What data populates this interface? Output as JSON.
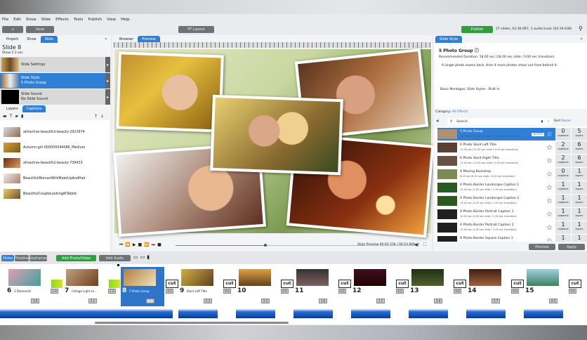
{
  "menu": [
    "File",
    "Edit",
    "Show",
    "Slide",
    "Effects",
    "Tools",
    "Publish",
    "View",
    "Help"
  ],
  "toolbar": {
    "home": "⌂",
    "save": "Save",
    "layout": "FF Layout",
    "publish": "Publish",
    "status": "27 slides, 02:36.067, 1 audio track (02:19.636)"
  },
  "left": {
    "tabs": [
      "Project",
      "Show",
      "Slide"
    ],
    "title": "Slide 8",
    "subtitle": "Show 2 2 sec",
    "rows": [
      {
        "t1": "Slide Settings",
        "t2": ""
      },
      {
        "t1": "Slide Style",
        "t2": "5 Photo Group"
      },
      {
        "t1": "Slide Sound",
        "t2": "No Slide Sound"
      }
    ],
    "layer_tabs": [
      "Layers",
      "Captions"
    ],
    "layers": [
      "attractive-beautiful-beauty-2923974",
      "Autumn-girl-000045044086_Medium",
      "attractive-beautiful-beauty-739433",
      "BeautifulWomanWithMakeUpAndHair",
      "BeautifulCoupleLookingAtTablet"
    ]
  },
  "center": {
    "tabs": [
      "Browser",
      "Preview"
    ],
    "status": "Style Preview 00:05.530 / 00:10.000"
  },
  "right": {
    "tab": "Slide Style",
    "title": "5 Photo Group",
    "duration": "Recommended Duration: 18.00 sec (18.00 sec slide / 0.00 sec transition)",
    "desc": "A single photo zooms back, then 4 more photos shear out from behind it.",
    "source": "Basic Montages, Slide Styles - Built In",
    "category_label": "Category:",
    "category": "All Effects",
    "search_placeholder": "Search",
    "sort_label": "Sort",
    "sort_value": "Name",
    "active": "active",
    "captions": "captions",
    "layers": "layers",
    "effects": [
      {
        "name": "5 Photo Group",
        "info": "18.00 sec (18.00 sec slide / 0.00 sec transition)",
        "captions": "0",
        "layers": "5"
      },
      {
        "name": "6 Photo Slant Left Title",
        "info": "12.00 sec (12.00 sec slide / 0.00 sec transition)",
        "captions": "2",
        "layers": "6"
      },
      {
        "name": "6 Photo Slant Right Title",
        "info": "12.00 sec (12.00 sec slide / 0.00 sec transition)",
        "captions": "2",
        "layers": "6"
      },
      {
        "name": "A Moving Backdrop",
        "info": "8.00 sec (8.00 sec slide / 0.00 sec transition)",
        "captions": "0",
        "layers": "1"
      },
      {
        "name": "A Photo Border Landscape Caption 1",
        "info": "10.00 sec (4.00 sec slide / 1.00 sec transition)",
        "captions": "1",
        "layers": "1"
      },
      {
        "name": "A Photo Border Landscape Caption 2",
        "info": "10.00 sec (4.00 sec slide / 1.00 sec transition)",
        "captions": "1",
        "layers": "1"
      },
      {
        "name": "A Photo Border Portrait Caption 1",
        "info": "10.00 sec (4.00 sec slide / 1.00 sec transition)",
        "captions": "1",
        "layers": "1"
      },
      {
        "name": "A Photo Border Portrait Caption 2",
        "info": "10.00 sec (4.00 sec slide / 1.00 sec transition)",
        "captions": "1",
        "layers": "1"
      },
      {
        "name": "A Photo Border Square Caption 1",
        "info": "10.00 sec (4.00 sec slide / 1.00 sec transition)",
        "captions": "1",
        "layers": "1"
      }
    ],
    "preview": "Preview",
    "apply": "Apply"
  },
  "bottom": {
    "tabs": [
      "Slides",
      "Timeline",
      "Keyframes"
    ],
    "add_photo": "Add Photo/Video",
    "add_audio": "Add Audio",
    "slides": [
      {
        "num": "6",
        "name": "3 Diamonds",
        "dur": "3.0"
      },
      {
        "num": "7",
        "name": "Collage Light Le...",
        "dur": "2.2"
      },
      {
        "num": "8",
        "name": "5 Photo Group",
        "dur": "2.2"
      },
      {
        "num": "9",
        "name": "Slant Left Title",
        "dur": "2.2"
      },
      {
        "num": "10",
        "name": "",
        "dur": "2.2"
      },
      {
        "num": "11",
        "name": "",
        "dur": "3.0"
      },
      {
        "num": "12",
        "name": "",
        "dur": "1.2"
      },
      {
        "num": "13",
        "name": "",
        "dur": "3.0"
      },
      {
        "num": "14",
        "name": "",
        "dur": "1.7"
      },
      {
        "num": "15",
        "name": "",
        "dur": "4.5"
      }
    ],
    "transitions": [
      "1.0",
      "1.0",
      "0.0",
      "0.0",
      "0.0",
      "0.0",
      "0.0",
      "0.0",
      "0.0",
      "0.0"
    ],
    "cut": "cut"
  }
}
